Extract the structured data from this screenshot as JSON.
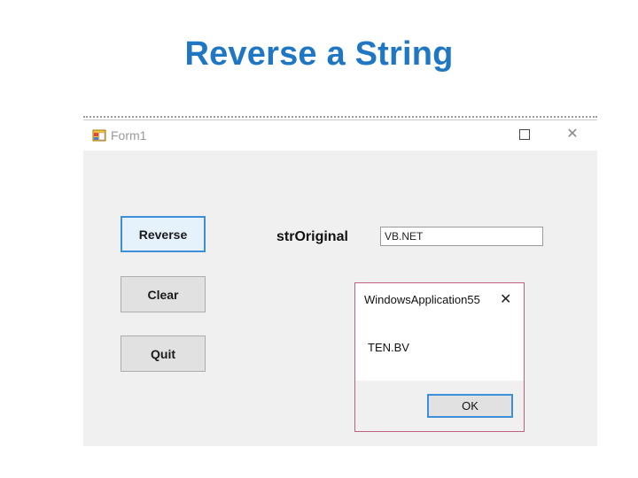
{
  "slide": {
    "title": "Reverse a String"
  },
  "window": {
    "title": "Form1",
    "maximize_glyph": "☐",
    "close_glyph": "✕"
  },
  "form": {
    "buttons": {
      "reverse": "Reverse",
      "clear": "Clear",
      "quit": "Quit"
    },
    "label": "strOriginal",
    "input_value": "VB.NET"
  },
  "message_box": {
    "title": "WindowsApplication55",
    "close_glyph": "✕",
    "message": "TEN.BV",
    "ok": "OK"
  },
  "colors": {
    "title": "#1f77c4",
    "focus_border": "#3c8fd8",
    "msgbox_border": "#c06080"
  },
  "icons": [
    "form-app-icon",
    "maximize-icon",
    "close-icon"
  ]
}
